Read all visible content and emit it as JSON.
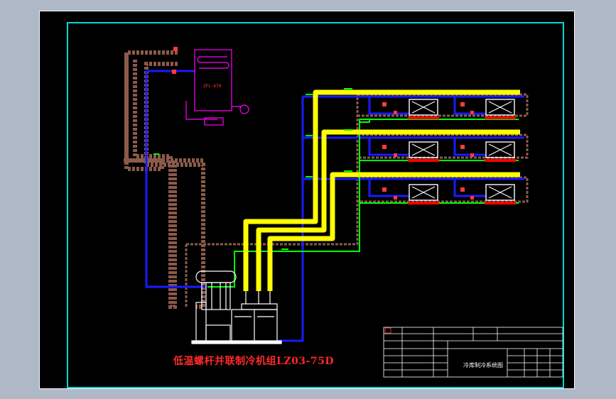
{
  "drawing": {
    "title": "低温螺杆并联制冷机组LZ03-75D",
    "condenser_label": "ZFL-670",
    "title_block": {
      "drawing_name": "冷库制冷系统图"
    }
  },
  "colors": {
    "sheet_background": "#000000",
    "frame": "#00d8d8",
    "title_text": "#ff2a2a",
    "suction_line": "#ffff00",
    "liquid_line": "#0000ff",
    "hot_gas_line": "#00ff00",
    "cooling_water_line": "#8b5a4a",
    "condenser": "#ff00ff",
    "evaporator_pan": "#ff0000"
  },
  "icons": [
    "evaporator-unit-icon",
    "compressor-unit-icon",
    "condenser-icon",
    "pump-icon",
    "valve-icon"
  ]
}
